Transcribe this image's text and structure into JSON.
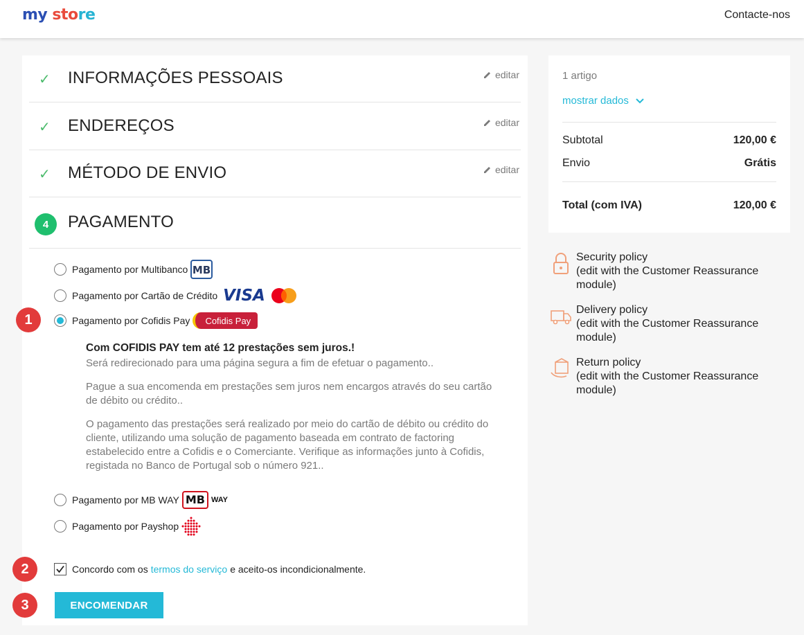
{
  "header": {
    "logo_part1": "my",
    "logo_part2": " sto",
    "logo_part3": "re",
    "contact": "Contacte-nos"
  },
  "steps": [
    {
      "title": "INFORMAÇÕES PESSOAIS",
      "edit": "editar"
    },
    {
      "title": "ENDEREÇOS",
      "edit": "editar"
    },
    {
      "title": "MÉTODO DE ENVIO",
      "edit": "editar"
    },
    {
      "number": "4",
      "title": "PAGAMENTO"
    }
  ],
  "payment": {
    "options": [
      {
        "label": "Pagamento por Multibanco",
        "logo": "MB"
      },
      {
        "label": "Pagamento por Cartão de Crédito",
        "logo": "VISA"
      },
      {
        "label": "Pagamento por Cofidis Pay",
        "logo": "Cofidis Pay"
      },
      {
        "label": "Pagamento por MB WAY",
        "logo_mb": "MB",
        "logo_way": "WAY"
      },
      {
        "label": "Pagamento por Payshop"
      }
    ],
    "selected_index": 2,
    "cofidis_info": {
      "heading": "Com COFIDIS PAY tem até 12 prestações sem juros.!",
      "p1": "Será redirecionado para uma página segura a fim de efetuar o pagamento..",
      "p2": "Pague a sua encomenda em prestações sem juros nem encargos através do seu cartão de débito ou crédito..",
      "p3": "O pagamento das prestações será realizado por meio do cartão de débito ou crédito do cliente, utilizando uma solução de pagamento baseada em contrato de factoring estabelecido entre a Cofidis e o Comerciante. Verifique as informações junto à Cofidis, registada no Banco de Portugal sob o número 921.."
    }
  },
  "terms": {
    "before": "Concordo com os",
    "link": "termos do serviço",
    "after": "e aceito-os incondicionalmente.",
    "checked": true
  },
  "order_button": "ENCOMENDAR",
  "badges": [
    "1",
    "2",
    "3"
  ],
  "summary": {
    "count": "1 artigo",
    "show_details": "mostrar dados",
    "subtotal_label": "Subtotal",
    "subtotal_value": "120,00 €",
    "shipping_label": "Envio",
    "shipping_value": "Grátis",
    "total_label": "Total (com IVA)",
    "total_value": "120,00 €"
  },
  "reassurance": [
    {
      "title": "Security policy",
      "desc": "(edit with the Customer Reassurance module)"
    },
    {
      "title": "Delivery policy",
      "desc": "(edit with the Customer Reassurance module)"
    },
    {
      "title": "Return policy",
      "desc": "(edit with the Customer Reassurance module)"
    }
  ],
  "colors": {
    "accent": "#24b9d7",
    "check": "#4cbb6c",
    "badge": "#e23b3b"
  }
}
